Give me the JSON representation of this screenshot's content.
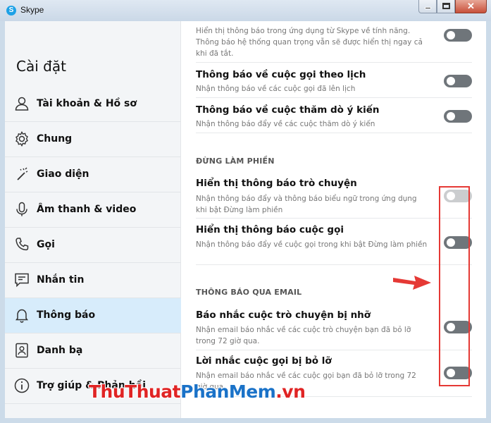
{
  "window": {
    "title": "Skype",
    "app_icon": "skype-logo-icon",
    "close_glyph": "✕"
  },
  "sidebar": {
    "title": "Cài đặt",
    "items": [
      {
        "label": "Tài khoản & Hồ sơ",
        "icon": "person-icon"
      },
      {
        "label": "Chung",
        "icon": "gear-icon"
      },
      {
        "label": "Giao diện",
        "icon": "magic-wand-icon"
      },
      {
        "label": "Âm thanh & video",
        "icon": "microphone-icon"
      },
      {
        "label": "Gọi",
        "icon": "phone-icon"
      },
      {
        "label": "Nhắn tin",
        "icon": "chat-icon"
      },
      {
        "label": "Thông báo",
        "icon": "bell-icon",
        "active": true
      },
      {
        "label": "Danh bạ",
        "icon": "contacts-icon"
      },
      {
        "label": "Trợ giúp & Phản hồi",
        "icon": "info-icon"
      }
    ]
  },
  "content": {
    "top_partial": {
      "desc": "Hiển thị thông báo trong ứng dụng từ Skype về tính năng. Thông báo hệ thống quan trọng vẫn sẽ được hiển thị ngay cả khi đã tắt.",
      "toggle": "off"
    },
    "settings_general": [
      {
        "title": "Thông báo về cuộc gọi theo lịch",
        "desc": "Nhận thông báo về các cuộc gọi đã lên lịch",
        "toggle": "off"
      },
      {
        "title": "Thông báo về cuộc thăm dò ý kiến",
        "desc": "Nhận thông báo đẩy về các cuộc thăm dò ý kiến",
        "toggle": "off"
      }
    ],
    "dnd_heading": "ĐỪNG LÀM PHIỀN",
    "settings_dnd": [
      {
        "title": "Hiển thị thông báo trò chuyện",
        "desc": "Nhận thông báo đẩy và thông báo biểu ngữ trong ứng dụng khi bật Đừng làm phiền",
        "toggle": "disabled"
      },
      {
        "title": "Hiển thị thông báo cuộc gọi",
        "desc": "Nhận thông báo đẩy về cuộc gọi trong khi bật Đừng làm phiền",
        "toggle": "off"
      }
    ],
    "email_heading": "THÔNG BÁO QUA EMAIL",
    "settings_email": [
      {
        "title": "Báo nhắc cuộc trò chuyện bị nhỡ",
        "desc": "Nhận email báo nhắc về các cuộc trò chuyện bạn đã bỏ lỡ trong 72 giờ qua.",
        "toggle": "off"
      },
      {
        "title": "Lời nhắc cuộc gọi bị bỏ lỡ",
        "desc": "Nhận email báo nhắc về các cuộc gọi bạn đã bỏ lỡ trong 72 giờ qua.",
        "toggle": "off"
      }
    ]
  },
  "watermark": {
    "part1": "ThuThuat",
    "part2": "PhanMem",
    "part3": ".vn"
  },
  "colors": {
    "accent": "#e53935",
    "active_nav": "#d7ecfb",
    "toggle_off": "#6f757a",
    "toggle_disabled": "#cbcdcf"
  }
}
